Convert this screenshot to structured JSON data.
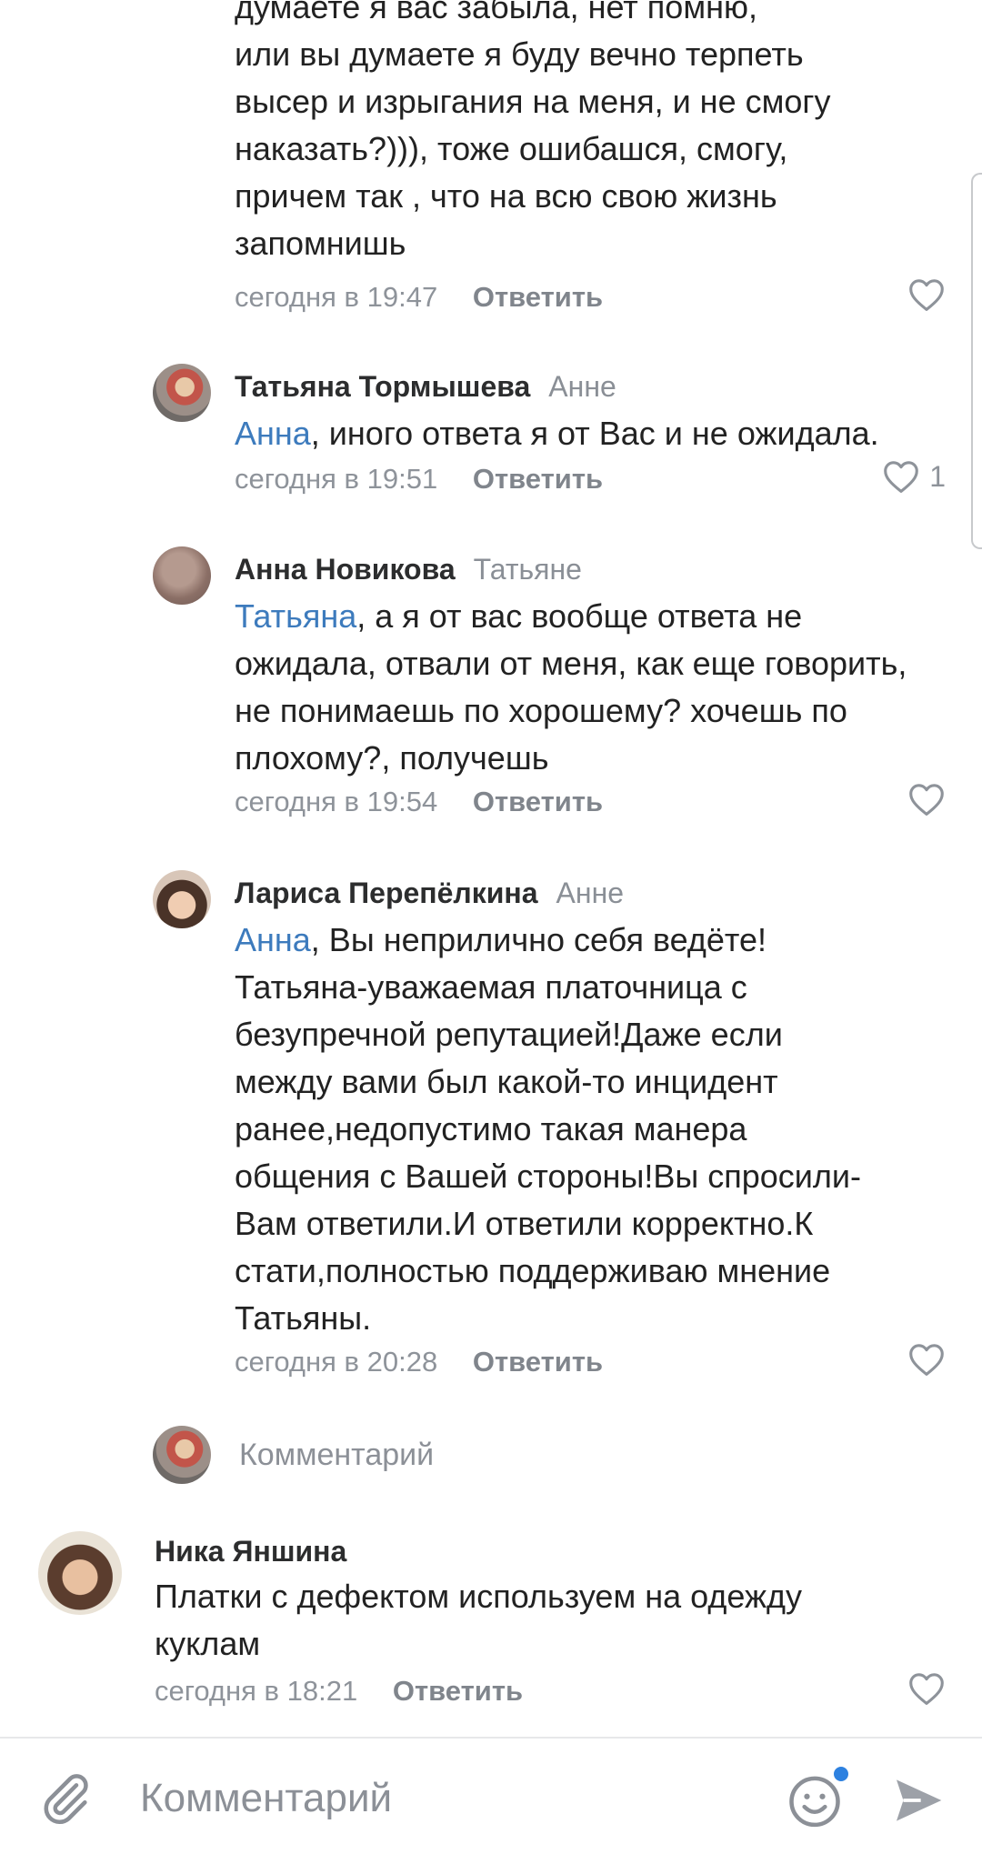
{
  "comments": [
    {
      "text_lines": [
        "думаете я вас забыла, нет помню,",
        "или вы думаете я  буду вечно терпеть",
        "высер и изрыгания на меня,  и не смогу",
        "наказать?))), тоже ошибашся, смогу,",
        "причем так , что на всю свою жизнь",
        "запомнишь"
      ],
      "time": "сегодня в 19:47",
      "reply_label": "Ответить"
    },
    {
      "author": "Татьяна Тормышева",
      "reply_to": "Анне",
      "mention": "Анна",
      "text": ", иного ответа я от Вас и не ожидала.",
      "time": "сегодня в 19:51",
      "reply_label": "Ответить",
      "likes": "1"
    },
    {
      "author": "Анна Новикова",
      "reply_to": "Татьяне",
      "mention": "Татьяна",
      "text": ", а я от вас вообще ответа не ожидала, отвали от меня, как еще говорить, не понимаешь по хорошему? хочешь по плохому?, получешь",
      "time": "сегодня в 19:54",
      "reply_label": "Ответить"
    },
    {
      "author": "Лариса Перепёлкина",
      "reply_to": "Анне",
      "mention": "Анна",
      "text": ", Вы неприлично себя ведёте! Татьяна-уважаемая платочница с безупречной репутацией!Даже если между вами был какой-то инцидент ранее,недопустимо такая манера общения с Вашей стороны!Вы спросили-Вам ответили.И ответили корректно.К стати,полностью поддерживаю мнение Татьяны.",
      "time": "сегодня в 20:28",
      "reply_label": "Ответить"
    },
    {
      "author": "Ника Яншина",
      "text": "Платки с дефектом используем на одежду куклам",
      "time": "сегодня в 18:21",
      "reply_label": "Ответить"
    }
  ],
  "thread_reply_placeholder": "Комментарий",
  "composer": {
    "placeholder": "Комментарий",
    "icons": [
      "attach-icon",
      "emoji-icon",
      "send-icon"
    ]
  },
  "colors": {
    "mention": "#3d7bbd",
    "meta": "#8e939a",
    "emoji_badge": "#2d81e0"
  }
}
